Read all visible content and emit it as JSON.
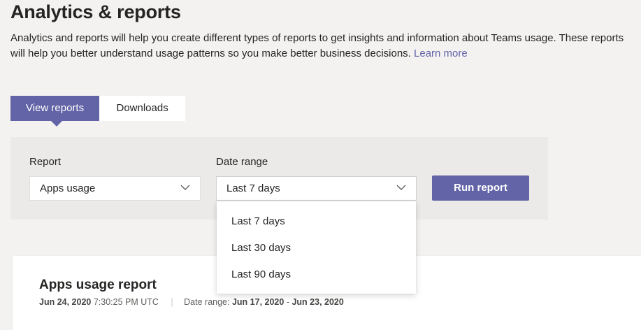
{
  "header": {
    "title": "Analytics & reports",
    "description": "Analytics and reports will help you create different types of reports to get insights and information about Teams usage. These reports will help you better understand usage patterns so you make better business decisions.",
    "learn_more": "Learn more"
  },
  "tabs": [
    {
      "label": "View reports",
      "active": true
    },
    {
      "label": "Downloads",
      "active": false
    }
  ],
  "filters": {
    "report_label": "Report",
    "report_value": "Apps usage",
    "date_range_label": "Date range",
    "date_range_value": "Last 7 days",
    "run_button": "Run report"
  },
  "date_range_options": [
    "Last 7 days",
    "Last 30 days",
    "Last 90 days"
  ],
  "report": {
    "title": "Apps usage report",
    "run_date": "Jun 24, 2020",
    "run_time": "7:30:25 PM UTC",
    "date_range_prefix": "Date range:",
    "range_start": "Jun 17, 2020",
    "range_separator": "-",
    "range_end": "Jun 23, 2020"
  },
  "colors": {
    "accent": "#6264a7",
    "background": "#f3f2f1",
    "panel": "#ebeae9"
  }
}
